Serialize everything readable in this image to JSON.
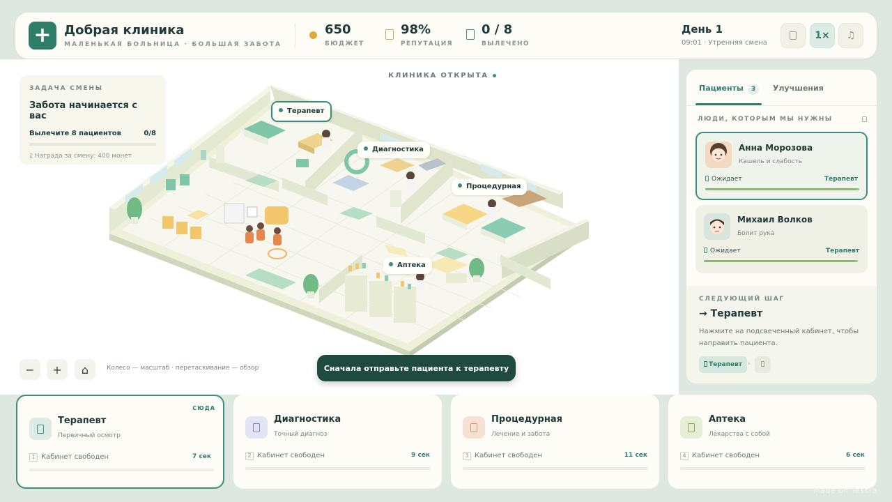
{
  "header": {
    "title": "Добрая клиника",
    "subtitle": "МАЛЕНЬКАЯ БОЛЬНИЦА · БОЛЬШАЯ ЗАБОТА",
    "stats": [
      {
        "value": "650",
        "label": "БЮДЖЕТ"
      },
      {
        "value": "98%",
        "label": "РЕПУТАЦИЯ"
      },
      {
        "value": "0 / 8",
        "label": "ВЫЛЕЧЕНО"
      }
    ],
    "day": "День 1",
    "time_shift": "09:01 · Утренняя смена",
    "speed_label": "1×",
    "music_icon": "♫"
  },
  "game": {
    "status": "КЛИНИКА ОТКРЫТА",
    "task": {
      "kicker": "ЗАДАЧА СМЕНЫ",
      "title": "Забота начинается с вас",
      "goal": "Вылечите 8 пациентов",
      "progress": "0/8",
      "progress_fraction": 0,
      "reward": "Награда за смену: 400 монет"
    },
    "rooms": [
      {
        "label": "Терапевт"
      },
      {
        "label": "Диагностика"
      },
      {
        "label": "Процедурная"
      },
      {
        "label": "Аптека"
      }
    ],
    "zoom_out": "−",
    "zoom_in": "+",
    "home": "⌂",
    "hint": "Колесо — масштаб · перетаскивание — обзор",
    "toast": "Сначала отправьте пациента к терапевту"
  },
  "panel": {
    "tabs": [
      {
        "label": "Пациенты",
        "count": "3"
      },
      {
        "label": "Улучшения"
      }
    ],
    "kicker": "ЛЮДИ, КОТОРЫМ МЫ НУЖНЫ",
    "patients": [
      {
        "name": "Анна Морозова",
        "complaint": "Кашель и слабость",
        "status": "Ожидает",
        "destination": "Терапевт",
        "patience": 0.98
      },
      {
        "name": "Михаил Волков",
        "complaint": "Болит рука",
        "status": "Ожидает",
        "destination": "Терапевт",
        "patience": 0.98
      }
    ],
    "next": {
      "kicker": "СЛЕДУЮЩИЙ ШАГ",
      "title": "→ Терапевт",
      "text": "Нажмите на подсвеченный кабинет, чтобы направить пациента.",
      "chip": "Терапевт",
      "arrow": "›"
    }
  },
  "cards": [
    {
      "title": "Терапевт",
      "subtitle": "Первичный осмотр",
      "num": "1",
      "state": "Кабинет свободен",
      "time": "7 сек",
      "badge": "СЮДА",
      "color": "#3b8f7a",
      "bg": "#dcebe3"
    },
    {
      "title": "Диагностика",
      "subtitle": "Точный диагноз",
      "num": "2",
      "state": "Кабинет свободен",
      "time": "9 сек",
      "color": "#7b86c6",
      "bg": "#e3e5f5"
    },
    {
      "title": "Процедурная",
      "subtitle": "Лечение и забота",
      "num": "3",
      "state": "Кабинет свободен",
      "time": "11 сек",
      "color": "#d99063",
      "bg": "#f7e1d3"
    },
    {
      "title": "Аптека",
      "subtitle": "Лекарства с собой",
      "num": "4",
      "state": "Кабинет свободен",
      "time": "6 сек",
      "color": "#8aa858",
      "bg": "#e6eed6"
    }
  ],
  "watermark": "Made on Tessra"
}
